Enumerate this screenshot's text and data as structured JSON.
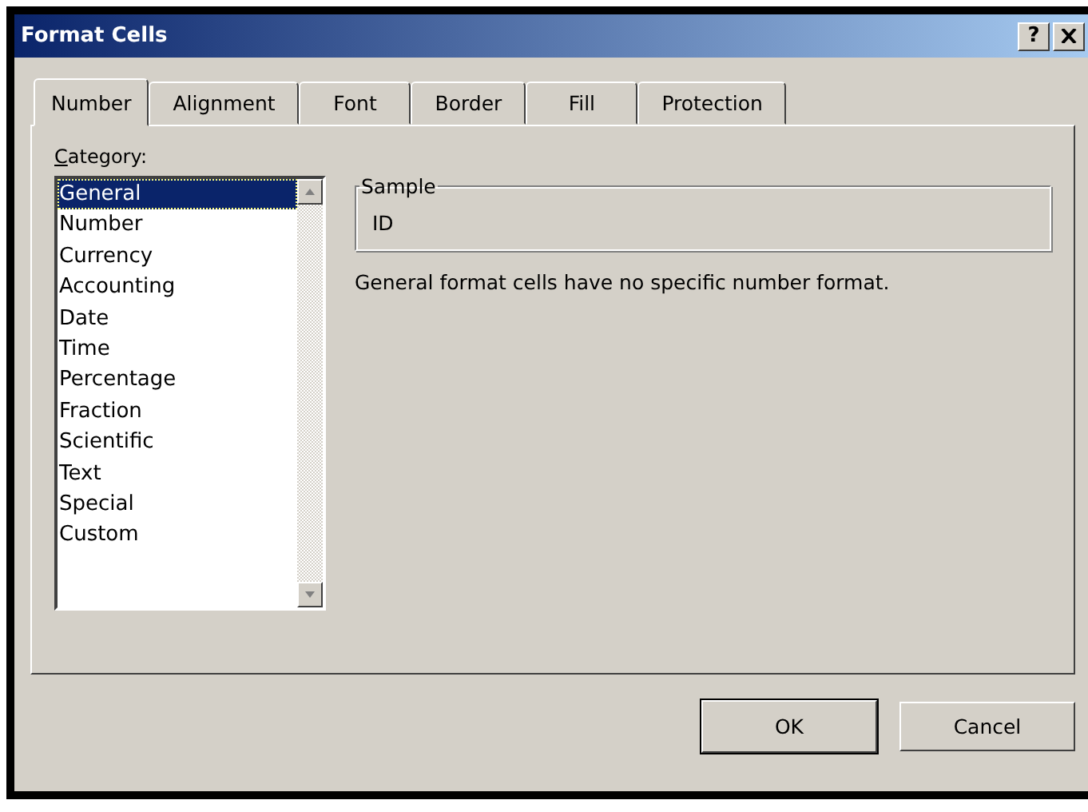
{
  "window": {
    "title": "Format Cells",
    "help": "?"
  },
  "tabs": [
    {
      "label": "Number",
      "selected": true
    },
    {
      "label": "Alignment",
      "selected": false
    },
    {
      "label": "Font",
      "selected": false
    },
    {
      "label": "Border",
      "selected": false
    },
    {
      "label": "Fill",
      "selected": false
    },
    {
      "label": "Protection",
      "selected": false
    }
  ],
  "category": {
    "label": "Category:",
    "items": [
      {
        "label": "General",
        "selected": true
      },
      {
        "label": "Number",
        "selected": false
      },
      {
        "label": "Currency",
        "selected": false
      },
      {
        "label": "Accounting",
        "selected": false
      },
      {
        "label": "Date",
        "selected": false
      },
      {
        "label": "Time",
        "selected": false
      },
      {
        "label": "Percentage",
        "selected": false
      },
      {
        "label": "Fraction",
        "selected": false
      },
      {
        "label": "Scientific",
        "selected": false
      },
      {
        "label": "Text",
        "selected": false
      },
      {
        "label": "Special",
        "selected": false
      },
      {
        "label": "Custom",
        "selected": false
      }
    ]
  },
  "sample": {
    "label": "Sample",
    "value": "ID"
  },
  "description": "General format cells have no specific number format.",
  "buttons": [
    {
      "label": "OK",
      "default": true
    },
    {
      "label": "Cancel",
      "default": false
    }
  ]
}
